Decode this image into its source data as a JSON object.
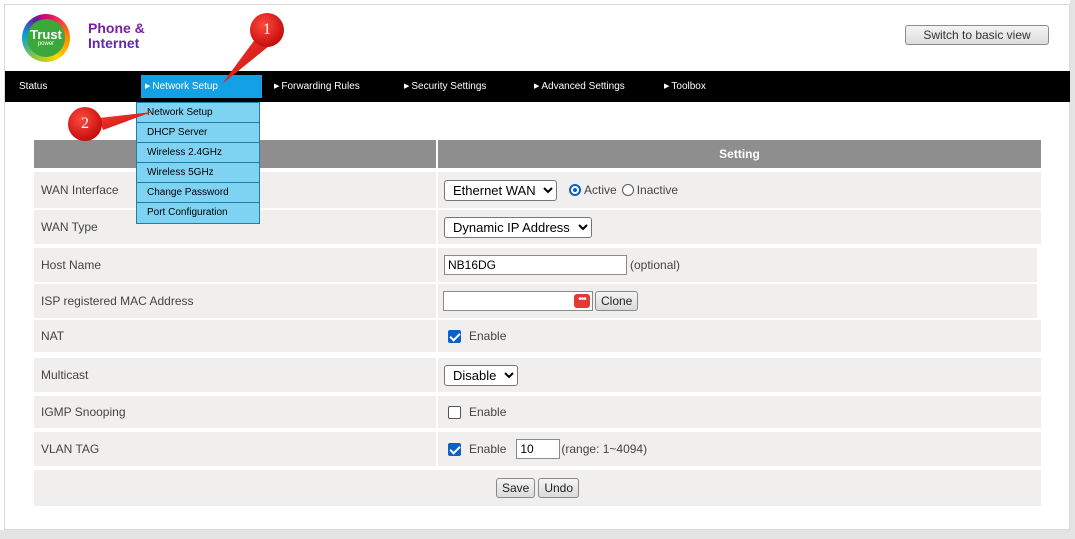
{
  "brand": {
    "badge_word": "Trust",
    "badge_sub": "power",
    "line1": "Phone &",
    "line2": "Internet"
  },
  "header": {
    "basic_view_button": "Switch to basic view"
  },
  "nav": {
    "items": [
      "Status",
      "Network Setup",
      "Forwarding Rules",
      "Security Settings",
      "Advanced Settings",
      "Toolbox"
    ],
    "active": "Network Setup"
  },
  "submenu": {
    "items": [
      "Network Setup",
      "DHCP Server",
      "Wireless 2.4GHz",
      "Wireless 5GHz",
      "Change Password",
      "Port Configuration"
    ]
  },
  "callouts": [
    "1",
    "2"
  ],
  "table": {
    "setting_header": "Setting",
    "rows": {
      "wan_interface": {
        "label": "WAN Interface",
        "selected": "Ethernet WAN",
        "radio_active": "Active",
        "radio_inactive": "Inactive"
      },
      "wan_type": {
        "label": "WAN Type",
        "selected": "Dynamic IP Address"
      },
      "host_name": {
        "label": "Host Name",
        "value": "NB16DG",
        "hint": "(optional)"
      },
      "isp_mac": {
        "label": "ISP registered MAC Address",
        "value": "",
        "clone_button": "Clone"
      },
      "nat": {
        "label": "NAT",
        "checkbox_label": "Enable",
        "checked": true
      },
      "multicast": {
        "label": "Multicast",
        "selected": "Disable"
      },
      "igmp": {
        "label": "IGMP Snooping",
        "checkbox_label": "Enable",
        "checked": false
      },
      "vlan": {
        "label": "VLAN TAG",
        "checkbox_label": "Enable",
        "checked": true,
        "value": "10",
        "range": "(range: 1~4094)"
      }
    },
    "save_button": "Save",
    "undo_button": "Undo"
  },
  "colors": {
    "nav_bg": "#000000",
    "nav_active": "#14a0e4",
    "submenu_bg": "#7fd3f2",
    "header_bg": "#8e8e8e",
    "row_bg": "#f0efee",
    "callout": "#d81b1b",
    "check": "#0b61c8"
  }
}
